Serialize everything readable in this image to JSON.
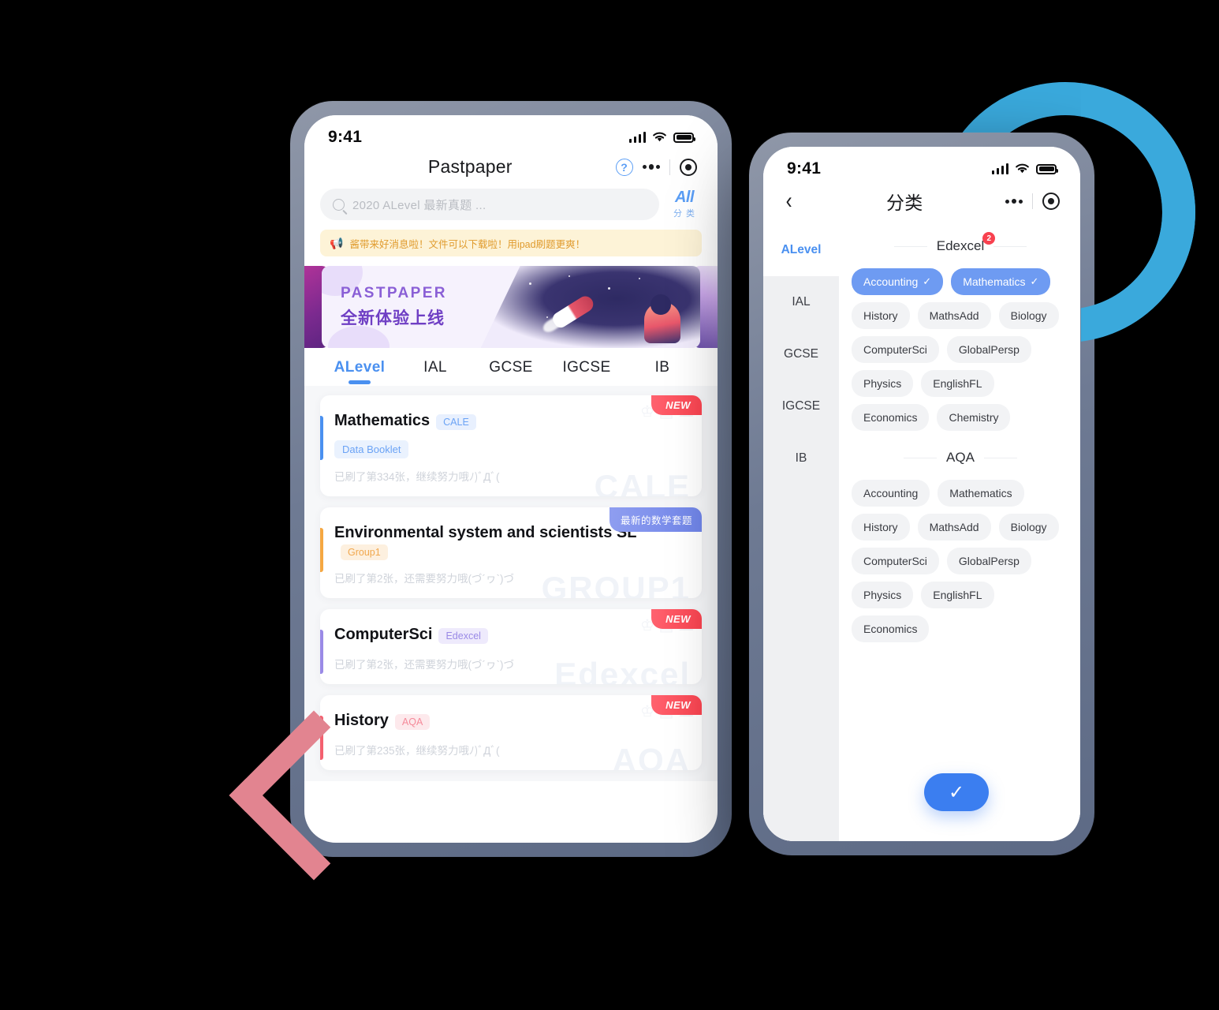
{
  "left_phone": {
    "status": {
      "time": "9:41"
    },
    "nav": {
      "title": "Pastpaper",
      "help_icon": "?",
      "more_icon": "more-dots",
      "target_icon": "target"
    },
    "search": {
      "placeholder": "2020 ALevel 最新真题 ...",
      "all_label": "All",
      "all_sub": "分 类"
    },
    "notice": {
      "text": "酱带来好消息啦！文件可以下载啦！用ipad刷题更爽！"
    },
    "banner": {
      "title_en": "PASTPAPER",
      "title_cn": "全新体验上线"
    },
    "tabs": [
      {
        "label": "ALevel",
        "active": true
      },
      {
        "label": "IAL",
        "active": false
      },
      {
        "label": "GCSE",
        "active": false
      },
      {
        "label": "IGCSE",
        "active": false
      },
      {
        "label": "IB",
        "active": false
      }
    ],
    "cards": [
      {
        "title": "Mathematics",
        "tag": "CALE",
        "tag_style": "blue",
        "accent": "#4a90f0",
        "badge": "NEW",
        "badge_style": "new",
        "sub_pill": "Data Booklet",
        "meta": "已刷了第334张，继续努力哦ﾉ)ﾞДﾞ(",
        "watermark": "CALE"
      },
      {
        "title": "Environmental system and scientists SL",
        "tag": "Group1",
        "tag_style": "orange",
        "accent": "#f5a742",
        "badge": "最新的数学套题",
        "badge_style": "txt",
        "sub_pill": "",
        "meta": "已刷了第2张，还需要努力哦(づ´ヮ`)づ",
        "watermark": "GROUP1"
      },
      {
        "title": "ComputerSci",
        "tag": "Edexcel",
        "tag_style": "purple",
        "accent": "#9a8ae6",
        "badge": "NEW",
        "badge_style": "new",
        "sub_pill": "",
        "meta": "已刷了第2张，还需要努力哦(づ´ヮ`)づ",
        "watermark": "Edexcel"
      },
      {
        "title": "History",
        "tag": "AQA",
        "tag_style": "red",
        "accent": "#f4606f",
        "badge": "NEW",
        "badge_style": "new",
        "sub_pill": "",
        "meta": "已刷了第235张，继续努力哦ﾉ)ﾞДﾞ(",
        "watermark": "AQA"
      }
    ]
  },
  "right_phone": {
    "status": {
      "time": "9:41"
    },
    "nav": {
      "title": "分类",
      "back_icon": "chevron-left",
      "more_icon": "more-dots",
      "target_icon": "target"
    },
    "sidebar": [
      {
        "label": "ALevel",
        "active": true
      },
      {
        "label": "IAL",
        "active": false
      },
      {
        "label": "GCSE",
        "active": false
      },
      {
        "label": "IGCSE",
        "active": false
      },
      {
        "label": "IB",
        "active": false
      }
    ],
    "sections": [
      {
        "name": "Edexcel",
        "badge": "2",
        "chips": [
          {
            "label": "Accounting",
            "selected": true
          },
          {
            "label": "Mathematics",
            "selected": true
          },
          {
            "label": "History",
            "selected": false
          },
          {
            "label": "MathsAdd",
            "selected": false
          },
          {
            "label": "Biology",
            "selected": false
          },
          {
            "label": "ComputerSci",
            "selected": false
          },
          {
            "label": "GlobalPersp",
            "selected": false
          },
          {
            "label": "Physics",
            "selected": false
          },
          {
            "label": "EnglishFL",
            "selected": false
          },
          {
            "label": "Economics",
            "selected": false
          },
          {
            "label": "Chemistry",
            "selected": false
          }
        ]
      },
      {
        "name": "AQA",
        "badge": "",
        "chips": [
          {
            "label": "Accounting",
            "selected": false
          },
          {
            "label": "Mathematics",
            "selected": false
          },
          {
            "label": "History",
            "selected": false
          },
          {
            "label": "MathsAdd",
            "selected": false
          },
          {
            "label": "Biology",
            "selected": false
          },
          {
            "label": "ComputerSci",
            "selected": false
          },
          {
            "label": "GlobalPersp",
            "selected": false
          },
          {
            "label": "Physics",
            "selected": false
          },
          {
            "label": "EnglishFL",
            "selected": false
          },
          {
            "label": "Economics",
            "selected": false
          }
        ]
      }
    ],
    "confirm_button": {
      "icon": "check"
    }
  },
  "decor": {
    "ring_color": "#3aa9dc",
    "chevron_color": "#e28490",
    "background": "#000000"
  }
}
